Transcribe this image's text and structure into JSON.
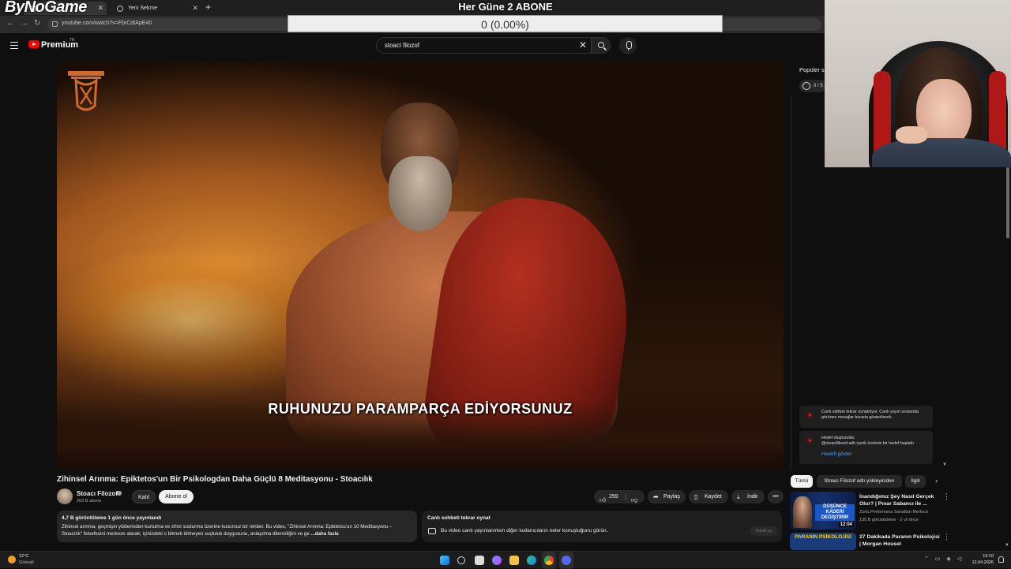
{
  "browser": {
    "tabs": [
      {
        "label": "ByNoGame"
      },
      {
        "label": "Yeni Sekme"
      }
    ],
    "new_tab_symbol": "+",
    "close_symbol": "✕",
    "url": "youtube.com/watch?v=FbrCdtApE40"
  },
  "overlay": {
    "stream_logo": "ByNoGame",
    "goal_title": "Her Güne 2 ABONE",
    "goal_value": "0 (0.00%)",
    "goal_min": "0",
    "goal_max": "2",
    "goal_progress_fraction": 0.0
  },
  "youtube": {
    "logo_text": "Premium",
    "country_code": "TR",
    "search_value": "stoaci filozof",
    "search_clear": "✕"
  },
  "player": {
    "caption": "RUHUNUZU PARAMPARÇA EDİYORSUNUZ"
  },
  "video": {
    "title": "Zihinsel Arınma: Epiktetos'un Bir Psikologdan Daha Güçlü 8 Meditasyonu - Stoacılık",
    "channel_name": "Stoacı Filozof",
    "subscriber_count": "263 B abone",
    "join_label": "Katıl",
    "subscribe_label": "Abone ol",
    "like_count": "259",
    "share_label": "Paylaş",
    "save_label": "Kaydet",
    "download_label": "İndir",
    "more_symbol": "•••",
    "description": {
      "stats": "4,7 B görüntüleme  1 gün önce yayınlandı",
      "text": "Zihinsel arınma, geçmişin yüklerinden kurtulma ve zihni susturma üzerine kusursuz bir rehber. Bu video, \"Zihinsel Arınma: Epiktetos'un 10 Meditasyonu – Stoacılık\" felsefesini merkeze alarak; içinizdeki o bitmek bilmeyen suçluluk duygusunu, anlaşılma dilenciliğini ve ge",
      "more_label": "...daha fazla"
    }
  },
  "chat_replay": {
    "title": "Canlı sohbeti tekrar oynat",
    "text": "Bu video canlı yayınlanırken diğer kullanıcıların neler konuştuğunu görün.",
    "button_label": "Paneli aç"
  },
  "sidebar": {
    "popular_label": "Popüler s",
    "goal_chip": "0 / 5",
    "notice1": "Canlı sohbet tekrar oynatılıyor. Canlı yayın sırasında görünen mesajlar burada gösterilecek.",
    "notice2_title": "Hedef oluşturuldu",
    "notice2_text": "@stoacifilozof adlı içerik üreticisi bir hedef başlattı",
    "notice2_link": "Hedefi göster",
    "filter_chips": [
      "Tümü",
      "Stoacı Filozof adlı yükleyiciden",
      "İlgili"
    ],
    "recommendations": [
      {
        "thumb_text": "DÜŞÜNCE KADERİ DEĞİŞTİRİR",
        "duration": "12:04",
        "title": "İnandığımız Şey Nasıl Gerçek Olur? | Pınar Sabancı ile ...",
        "channel": "Zorlu Performans Sanatları Merkezi",
        "stats": "135 B görüntüleme · 2 yıl önce"
      },
      {
        "thumb_text": "PARANIN PSİKOLOJİSİ",
        "title": "27 Dakikada Paranın Psikolojisi | Morgan Housel"
      }
    ]
  },
  "taskbar": {
    "weather_temp": "12°C",
    "weather_desc": "Güneşli",
    "time": "13:10",
    "date": "12.04.2026"
  },
  "colors": {
    "background": "#0f0f0f",
    "youtube_red": "#ff0000",
    "link_blue": "#3ea6ff",
    "chip_active": "#f1f1f1"
  }
}
